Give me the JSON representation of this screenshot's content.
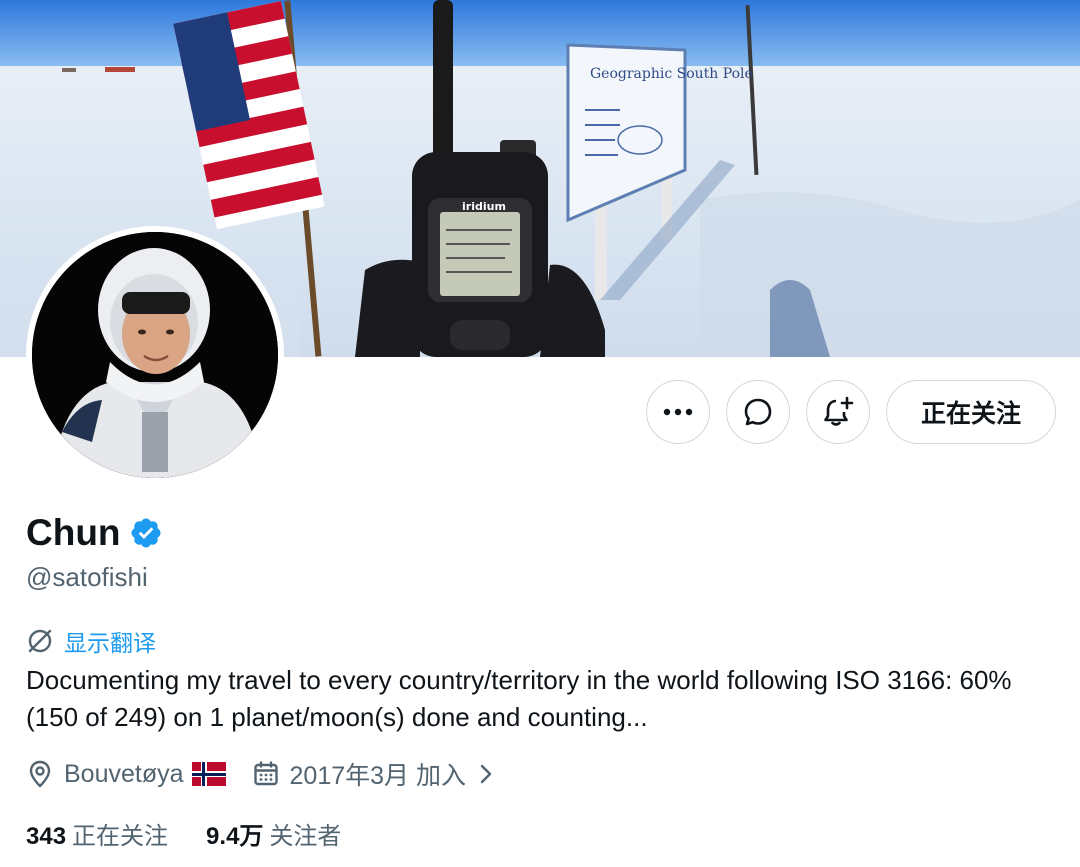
{
  "banner": {
    "sign_text": "Geographic South Pole",
    "device_brand": "iridium"
  },
  "actions": {
    "follow_label": "正在关注"
  },
  "profile": {
    "name": "Chun",
    "handle": "@satofishi",
    "translate_label": "显示翻译",
    "bio": "Documenting my travel to every country/territory in the world following ISO 3166: 60% (150 of 249) on 1 planet/moon(s) done and counting...",
    "location": "Bouvetøya",
    "joined": "2017年3月 加入"
  },
  "stats": {
    "following_count": "343",
    "following_label": "正在关注",
    "followers_count": "9.4万",
    "followers_label": "关注者"
  },
  "colors": {
    "accent": "#1d9bf0",
    "text": "#0f1419",
    "secondary": "#536471",
    "border": "#cfd9de"
  },
  "icons": [
    "more-icon",
    "message-icon",
    "notification-plus-icon",
    "verified-badge-icon",
    "translate-icon",
    "location-pin-icon",
    "calendar-icon",
    "chevron-right-icon",
    "norway-flag-icon"
  ]
}
